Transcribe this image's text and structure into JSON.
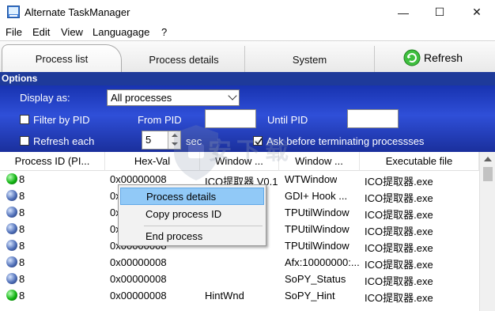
{
  "window": {
    "title": "Alternate TaskManager",
    "controls": {
      "minimize": "—",
      "maximize": "☐",
      "close": "✕"
    }
  },
  "menu": [
    "File",
    "Edit",
    "View",
    "Languagage",
    "?"
  ],
  "tabs": [
    "Process list",
    "Process details",
    "System"
  ],
  "refresh_label": "Refresh",
  "options": {
    "header": "Options",
    "display_as_label": "Display as:",
    "display_as_value": "All processes",
    "filter_pid_label": "Filter by PID",
    "from_pid_label": "From PID",
    "until_pid_label": "Until PID",
    "refresh_each_label": "Refresh each",
    "refresh_each_value": "5",
    "refresh_unit": "sec",
    "ask_before_label": "Ask before terminating processses",
    "ask_before_checked": true
  },
  "table": {
    "columns": [
      "Process ID (PI...",
      "Hex-Val",
      "Window ...",
      "Window ...",
      "Executable file"
    ],
    "rows": [
      {
        "status": "green",
        "pid": "8",
        "hex": "0x00000008",
        "win1": "ICO提取器 V0.1...",
        "win2": "WTWindow",
        "exe": "ICO提取器.exe"
      },
      {
        "status": "blue",
        "pid": "8",
        "hex": "0x00000008",
        "win1": "",
        "win2": "GDI+ Hook ...",
        "exe": "ICO提取器.exe"
      },
      {
        "status": "blue",
        "pid": "8",
        "hex": "0x00000008",
        "win1": "",
        "win2": "TPUtilWindow",
        "exe": "ICO提取器.exe"
      },
      {
        "status": "blue",
        "pid": "8",
        "hex": "0x00000008",
        "win1": "",
        "win2": "TPUtilWindow",
        "exe": "ICO提取器.exe"
      },
      {
        "status": "blue",
        "pid": "8",
        "hex": "0x00000008",
        "win1": "",
        "win2": "TPUtilWindow",
        "exe": "ICO提取器.exe"
      },
      {
        "status": "blue",
        "pid": "8",
        "hex": "0x00000008",
        "win1": "",
        "win2": "Afx:10000000:...",
        "exe": "ICO提取器.exe"
      },
      {
        "status": "blue",
        "pid": "8",
        "hex": "0x00000008",
        "win1": "",
        "win2": "SoPY_Status",
        "exe": "ICO提取器.exe"
      },
      {
        "status": "green",
        "pid": "8",
        "hex": "0x00000008",
        "win1": "HintWnd",
        "win2": "SoPY_Hint",
        "exe": "ICO提取器.exe"
      }
    ]
  },
  "context_menu": [
    "Process details",
    "Copy process ID",
    "End process"
  ],
  "watermark": "安下载",
  "colors": {
    "options_bg": "#2440c4",
    "status_green": "#12b312",
    "status_blue": "#4f6fb8",
    "menu_highlight": "#91c9f7"
  }
}
